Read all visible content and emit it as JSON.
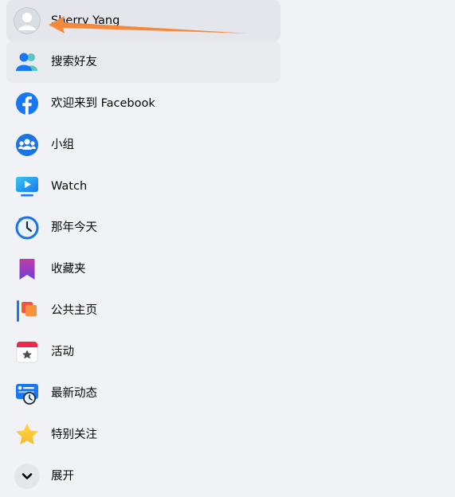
{
  "sidebar": {
    "profile": {
      "name": "Sherry Yang",
      "icon": "avatar-icon"
    },
    "items": [
      {
        "label": "搜索好友",
        "icon": "find-friends-icon"
      },
      {
        "label": "欢迎来到 Facebook",
        "icon": "facebook-icon"
      },
      {
        "label": "小组",
        "icon": "groups-icon"
      },
      {
        "label": "Watch",
        "icon": "watch-icon"
      },
      {
        "label": "那年今天",
        "icon": "memories-icon"
      },
      {
        "label": "收藏夹",
        "icon": "saved-icon"
      },
      {
        "label": "公共主页",
        "icon": "pages-icon"
      },
      {
        "label": "活动",
        "icon": "events-icon"
      },
      {
        "label": "最新动态",
        "icon": "most-recent-icon"
      },
      {
        "label": "特别关注",
        "icon": "favorites-icon"
      }
    ],
    "expand": {
      "label": "展开",
      "icon": "chevron-down-icon"
    }
  },
  "annotation": {
    "icon": "orange-arrow-icon",
    "color": "#f5893b"
  },
  "colors": {
    "background": "#f0f2f5",
    "hover": "#e4e6eb",
    "facebook_blue": "#1877f2"
  }
}
